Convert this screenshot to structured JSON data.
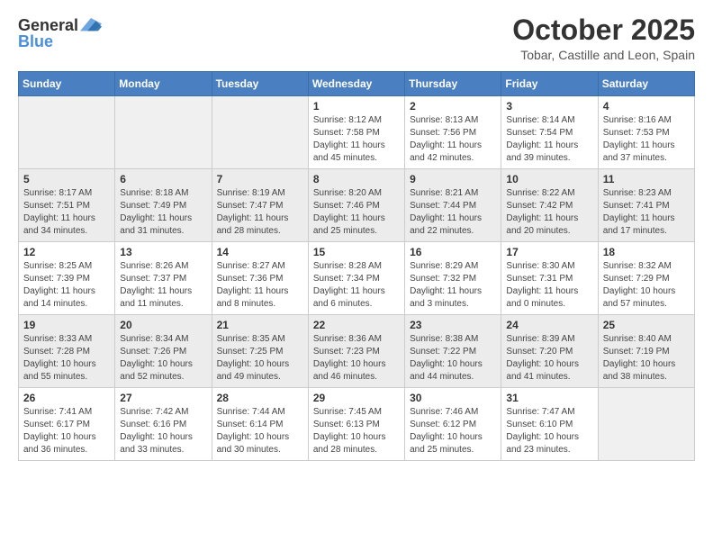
{
  "header": {
    "logo_general": "General",
    "logo_blue": "Blue",
    "title": "October 2025",
    "subtitle": "Tobar, Castille and Leon, Spain"
  },
  "columns": [
    "Sunday",
    "Monday",
    "Tuesday",
    "Wednesday",
    "Thursday",
    "Friday",
    "Saturday"
  ],
  "weeks": [
    [
      {
        "day": "",
        "info": ""
      },
      {
        "day": "",
        "info": ""
      },
      {
        "day": "",
        "info": ""
      },
      {
        "day": "1",
        "info": "Sunrise: 8:12 AM\nSunset: 7:58 PM\nDaylight: 11 hours\nand 45 minutes."
      },
      {
        "day": "2",
        "info": "Sunrise: 8:13 AM\nSunset: 7:56 PM\nDaylight: 11 hours\nand 42 minutes."
      },
      {
        "day": "3",
        "info": "Sunrise: 8:14 AM\nSunset: 7:54 PM\nDaylight: 11 hours\nand 39 minutes."
      },
      {
        "day": "4",
        "info": "Sunrise: 8:16 AM\nSunset: 7:53 PM\nDaylight: 11 hours\nand 37 minutes."
      }
    ],
    [
      {
        "day": "5",
        "info": "Sunrise: 8:17 AM\nSunset: 7:51 PM\nDaylight: 11 hours\nand 34 minutes."
      },
      {
        "day": "6",
        "info": "Sunrise: 8:18 AM\nSunset: 7:49 PM\nDaylight: 11 hours\nand 31 minutes."
      },
      {
        "day": "7",
        "info": "Sunrise: 8:19 AM\nSunset: 7:47 PM\nDaylight: 11 hours\nand 28 minutes."
      },
      {
        "day": "8",
        "info": "Sunrise: 8:20 AM\nSunset: 7:46 PM\nDaylight: 11 hours\nand 25 minutes."
      },
      {
        "day": "9",
        "info": "Sunrise: 8:21 AM\nSunset: 7:44 PM\nDaylight: 11 hours\nand 22 minutes."
      },
      {
        "day": "10",
        "info": "Sunrise: 8:22 AM\nSunset: 7:42 PM\nDaylight: 11 hours\nand 20 minutes."
      },
      {
        "day": "11",
        "info": "Sunrise: 8:23 AM\nSunset: 7:41 PM\nDaylight: 11 hours\nand 17 minutes."
      }
    ],
    [
      {
        "day": "12",
        "info": "Sunrise: 8:25 AM\nSunset: 7:39 PM\nDaylight: 11 hours\nand 14 minutes."
      },
      {
        "day": "13",
        "info": "Sunrise: 8:26 AM\nSunset: 7:37 PM\nDaylight: 11 hours\nand 11 minutes."
      },
      {
        "day": "14",
        "info": "Sunrise: 8:27 AM\nSunset: 7:36 PM\nDaylight: 11 hours\nand 8 minutes."
      },
      {
        "day": "15",
        "info": "Sunrise: 8:28 AM\nSunset: 7:34 PM\nDaylight: 11 hours\nand 6 minutes."
      },
      {
        "day": "16",
        "info": "Sunrise: 8:29 AM\nSunset: 7:32 PM\nDaylight: 11 hours\nand 3 minutes."
      },
      {
        "day": "17",
        "info": "Sunrise: 8:30 AM\nSunset: 7:31 PM\nDaylight: 11 hours\nand 0 minutes."
      },
      {
        "day": "18",
        "info": "Sunrise: 8:32 AM\nSunset: 7:29 PM\nDaylight: 10 hours\nand 57 minutes."
      }
    ],
    [
      {
        "day": "19",
        "info": "Sunrise: 8:33 AM\nSunset: 7:28 PM\nDaylight: 10 hours\nand 55 minutes."
      },
      {
        "day": "20",
        "info": "Sunrise: 8:34 AM\nSunset: 7:26 PM\nDaylight: 10 hours\nand 52 minutes."
      },
      {
        "day": "21",
        "info": "Sunrise: 8:35 AM\nSunset: 7:25 PM\nDaylight: 10 hours\nand 49 minutes."
      },
      {
        "day": "22",
        "info": "Sunrise: 8:36 AM\nSunset: 7:23 PM\nDaylight: 10 hours\nand 46 minutes."
      },
      {
        "day": "23",
        "info": "Sunrise: 8:38 AM\nSunset: 7:22 PM\nDaylight: 10 hours\nand 44 minutes."
      },
      {
        "day": "24",
        "info": "Sunrise: 8:39 AM\nSunset: 7:20 PM\nDaylight: 10 hours\nand 41 minutes."
      },
      {
        "day": "25",
        "info": "Sunrise: 8:40 AM\nSunset: 7:19 PM\nDaylight: 10 hours\nand 38 minutes."
      }
    ],
    [
      {
        "day": "26",
        "info": "Sunrise: 7:41 AM\nSunset: 6:17 PM\nDaylight: 10 hours\nand 36 minutes."
      },
      {
        "day": "27",
        "info": "Sunrise: 7:42 AM\nSunset: 6:16 PM\nDaylight: 10 hours\nand 33 minutes."
      },
      {
        "day": "28",
        "info": "Sunrise: 7:44 AM\nSunset: 6:14 PM\nDaylight: 10 hours\nand 30 minutes."
      },
      {
        "day": "29",
        "info": "Sunrise: 7:45 AM\nSunset: 6:13 PM\nDaylight: 10 hours\nand 28 minutes."
      },
      {
        "day": "30",
        "info": "Sunrise: 7:46 AM\nSunset: 6:12 PM\nDaylight: 10 hours\nand 25 minutes."
      },
      {
        "day": "31",
        "info": "Sunrise: 7:47 AM\nSunset: 6:10 PM\nDaylight: 10 hours\nand 23 minutes."
      },
      {
        "day": "",
        "info": ""
      }
    ]
  ]
}
